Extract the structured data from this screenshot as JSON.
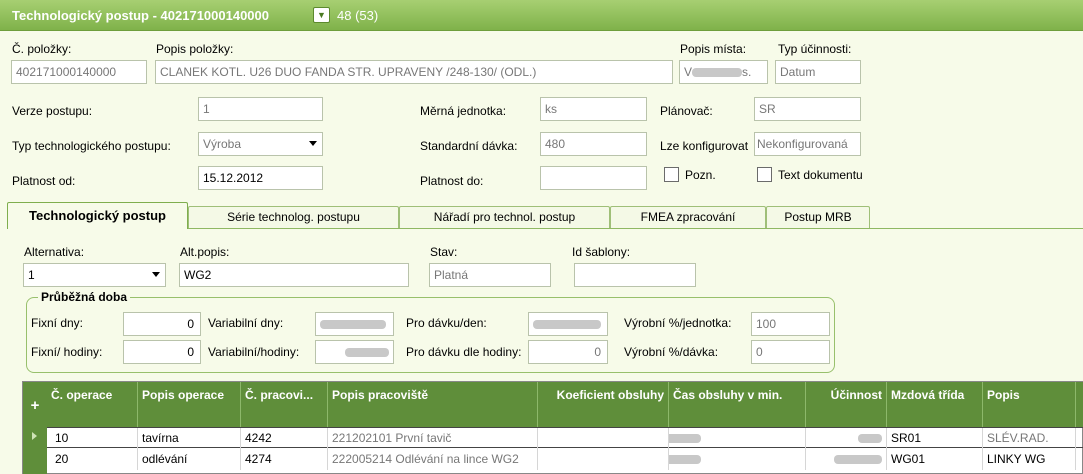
{
  "header": {
    "title": "Technologický postup - 402171000140000",
    "record_counter": "48 (53)"
  },
  "top": {
    "item_no_label": "Č. položky:",
    "item_no": "402171000140000",
    "item_desc_label": "Popis položky:",
    "item_desc": "CLANEK KOTL. U26 DUO FANDA STR. UPRAVENY /248-130/ (ODL.)",
    "place_desc_label": "Popis místa:",
    "place_desc": "V",
    "place_desc_tail": "s.",
    "efficiency_type_label": "Typ účinnosti:",
    "efficiency_type": "Datum"
  },
  "form": {
    "version_label": "Verze postupu:",
    "version": "1",
    "unit_label": "Měrná jednotka:",
    "unit": "ks",
    "planner_label": "Plánovač:",
    "planner": "SR",
    "type_label": "Typ technologického postupu:",
    "type": "Výroba",
    "std_batch_label": "Standardní dávka:",
    "std_batch": "480",
    "configurable_label": "Lze konfigurovat",
    "configurable": "Nekonfigurovaná",
    "valid_from_label": "Platnost od:",
    "valid_from": "15.12.2012",
    "valid_to_label": "Platnost do:",
    "valid_to": "",
    "note_label": "Pozn.",
    "doc_text_label": "Text dokumentu"
  },
  "tabs": [
    {
      "label": "Technologický postup"
    },
    {
      "label": "Série technolog. postupu"
    },
    {
      "label": "Nářadí pro technol. postup"
    },
    {
      "label": "FMEA zpracování"
    },
    {
      "label": "Postup MRB"
    }
  ],
  "alt": {
    "alternative_label": "Alternativa:",
    "alternative": "1",
    "alt_desc_label": "Alt.popis:",
    "alt_desc": "WG2",
    "state_label": "Stav:",
    "state": "Platná",
    "template_label": "Id šablony:",
    "template": ""
  },
  "lead_time": {
    "title": "Průběžná doba",
    "fixed_days_label": "Fixní dny:",
    "fixed_days": "0",
    "var_days_label": "Variabilní dny:",
    "per_batch_day_label": "Pro dávku/den:",
    "prod_pct_unit_label": "Výrobní %/jednotka:",
    "prod_pct_unit": "100",
    "fixed_hours_label": "Fixní/ hodiny:",
    "fixed_hours": "0",
    "var_hours_label": "Variabilní/hodiny:",
    "per_batch_hour_label": "Pro dávku dle hodiny:",
    "per_batch_hour": "0",
    "prod_pct_batch_label": "Výrobní %/dávka:",
    "prod_pct_batch": "0"
  },
  "grid": {
    "add_label": "+",
    "columns": [
      "Č. operace",
      "Popis operace",
      "Č. pracovi...",
      "Popis pracoviště",
      "Koeficient obsluhy",
      "Čas obsluhy v min.",
      "Účinnost",
      "Mzdová třída",
      "Popis"
    ],
    "rows": [
      {
        "op_no": "10",
        "op_desc": "tavírna",
        "wc_no": "4242",
        "wc_desc": "221202101 První tavič",
        "wage": "SR01",
        "desc": "SLÉV.RAD."
      },
      {
        "op_no": "20",
        "op_desc": "odlévání",
        "wc_no": "4274",
        "wc_desc": "222005214 Odlévání na lince WG2",
        "wage": "WG01",
        "desc": "LINKY WG"
      }
    ]
  },
  "colors": {
    "accent": "#7fb24a",
    "grid_header": "#5f8e3a",
    "background": "#f7fbe9"
  }
}
